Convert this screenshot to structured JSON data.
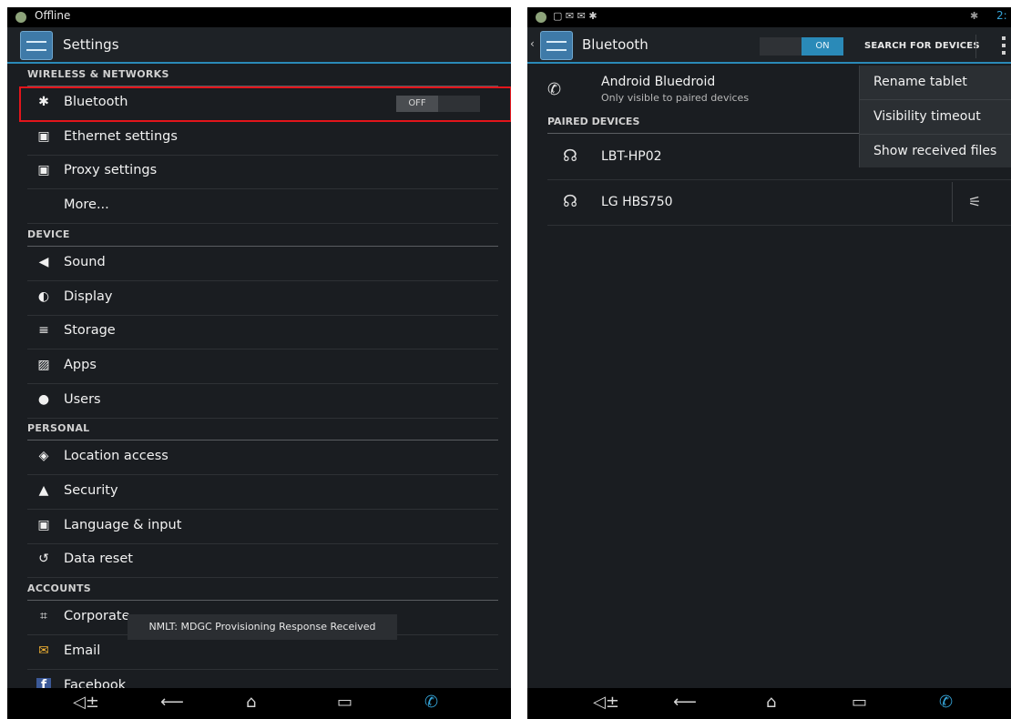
{
  "left": {
    "status": {
      "text": "Offline"
    },
    "title": "Settings",
    "sections": [
      {
        "label": "WIRELESS & NETWORKS"
      },
      {
        "label": "DEVICE"
      },
      {
        "label": "PERSONAL"
      },
      {
        "label": "ACCOUNTS"
      }
    ],
    "items": [
      {
        "label": "Bluetooth",
        "icon": "bluetooth-icon"
      },
      {
        "label": "Ethernet settings",
        "icon": "ethernet-icon"
      },
      {
        "label": "Proxy settings",
        "icon": "proxy-icon"
      },
      {
        "label": "More..."
      },
      {
        "label": "Sound",
        "icon": "speaker-icon"
      },
      {
        "label": "Display",
        "icon": "display-icon"
      },
      {
        "label": "Storage",
        "icon": "storage-icon"
      },
      {
        "label": "Apps",
        "icon": "apps-icon"
      },
      {
        "label": "Users",
        "icon": "users-icon"
      },
      {
        "label": "Location access",
        "icon": "location-icon"
      },
      {
        "label": "Security",
        "icon": "lock-icon"
      },
      {
        "label": "Language & input",
        "icon": "keyboard-icon"
      },
      {
        "label": "Data reset",
        "icon": "reset-icon"
      },
      {
        "label": "Corporate",
        "icon": "corporate-icon"
      },
      {
        "label": "Email",
        "icon": "email-icon"
      },
      {
        "label": "Facebook",
        "icon": "facebook-icon"
      }
    ],
    "bluetooth_toggle": "OFF",
    "toast": "NMLT: MDGC Provisioning Response Received"
  },
  "right": {
    "status": {
      "time": "2:"
    },
    "title": "Bluetooth",
    "switch": "ON",
    "search_button": "SEARCH FOR DEVICES",
    "local_device": {
      "name": "Android Bluedroid",
      "subtitle": "Only visible to paired devices"
    },
    "paired_section": "PAIRED DEVICES",
    "paired": [
      {
        "name": "LBT-HP02"
      },
      {
        "name": "LG HBS750"
      }
    ],
    "menu": [
      {
        "label": "Rename tablet"
      },
      {
        "label": "Visibility timeout"
      },
      {
        "label": "Show received files"
      }
    ]
  },
  "colors": {
    "accent": "#2a8ab8",
    "highlight": "#e3151b",
    "background": "#1a1d21"
  }
}
